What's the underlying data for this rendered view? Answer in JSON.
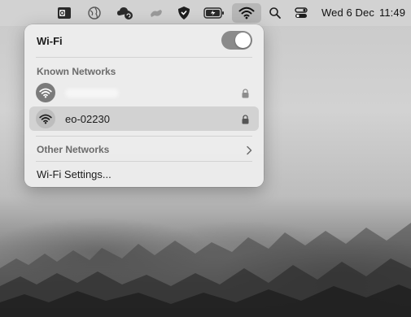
{
  "menubar": {
    "icons": [
      "outlook-icon",
      "globe-icon",
      "cloud-sync-icon",
      "link-icon",
      "shield-icon",
      "battery-charging-icon",
      "wifi-icon",
      "search-icon",
      "control-center-icon"
    ],
    "clock": {
      "date": "Wed 6 Dec",
      "time": "11:49"
    }
  },
  "wifi_panel": {
    "title": "Wi-Fi",
    "enabled": true,
    "known_networks_label": "Known Networks",
    "known_networks": [
      {
        "name": "",
        "secured": true,
        "connected": false
      },
      {
        "name": "eo-02230",
        "secured": true,
        "connected": true
      }
    ],
    "other_networks_label": "Other Networks",
    "settings_label": "Wi-Fi Settings..."
  },
  "colors": {
    "panel_bg": "#ececec",
    "selected_row": "#d2d2d2",
    "toggle_on": "#8a8a8a"
  }
}
